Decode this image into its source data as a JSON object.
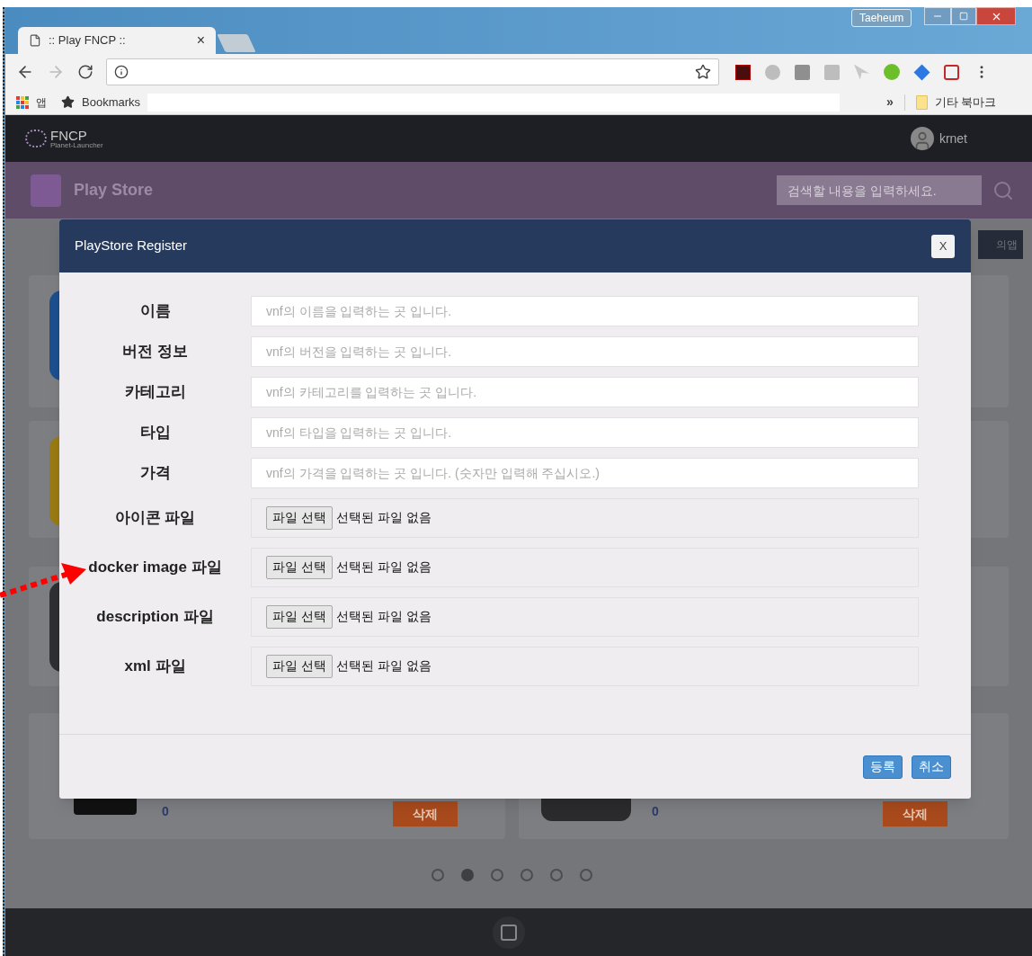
{
  "browser": {
    "profile": "Taeheum",
    "tab": {
      "title": ":: Play FNCP ::",
      "close": "×"
    },
    "bookmarks_bar": {
      "apps": "앱",
      "bookmarks": "Bookmarks",
      "overflow": "»",
      "other": "기타 북마크"
    }
  },
  "app": {
    "logo": "FNCP",
    "logo_sub": "Planet-Launcher",
    "user": "krnet",
    "section_title": "Play Store",
    "search": {
      "placeholder": "검색할 내용을 입력하세요."
    },
    "behind_button": "의앱"
  },
  "cards": [
    {
      "kind": "tile",
      "color": "#1c4f8f"
    },
    {
      "kind": "blank"
    },
    {
      "kind": "tile",
      "color": "#9a7a12"
    },
    {
      "kind": "blank"
    },
    {
      "kind": "tile",
      "color": "#2e2f33"
    },
    {
      "kind": "blank"
    },
    {
      "kind": "full",
      "count": "0",
      "delete": "삭제"
    },
    {
      "kind": "full",
      "count": "0",
      "delete": "삭제"
    }
  ],
  "pager": [
    {
      "selected": false
    },
    {
      "selected": true
    },
    {
      "selected": false
    },
    {
      "selected": false
    },
    {
      "selected": false
    },
    {
      "selected": false
    }
  ],
  "modal": {
    "title": "PlayStore Register",
    "close": "X",
    "fields": [
      {
        "kind": "text",
        "label": "이름",
        "placeholder": "vnf의 이름을 입력하는 곳 입니다."
      },
      {
        "kind": "text",
        "label": "버전 정보",
        "placeholder": "vnf의 버전을 입력하는 곳 입니다."
      },
      {
        "kind": "text",
        "label": "카테고리",
        "placeholder": "vnf의 카테고리를 입력하는 곳 입니다."
      },
      {
        "kind": "text",
        "label": "타입",
        "placeholder": "vnf의 타입을 입력하는 곳 입니다."
      },
      {
        "kind": "text",
        "label": "가격",
        "placeholder": "vnf의 가격을 입력하는 곳 입니다. (숫자만 입력해 주십시오.)"
      },
      {
        "kind": "file",
        "label": "아이콘 파일",
        "button": "파일 선택",
        "status": "선택된 파일 없음"
      },
      {
        "kind": "file",
        "label": "docker image 파일",
        "button": "파일 선택",
        "status": "선택된 파일 없음"
      },
      {
        "kind": "file",
        "label": "description 파일",
        "button": "파일 선택",
        "status": "선택된 파일 없음"
      },
      {
        "kind": "file",
        "label": "xml 파일",
        "button": "파일 선택",
        "status": "선택된 파일 없음"
      }
    ],
    "buttons": [
      "등록",
      "취소"
    ]
  }
}
